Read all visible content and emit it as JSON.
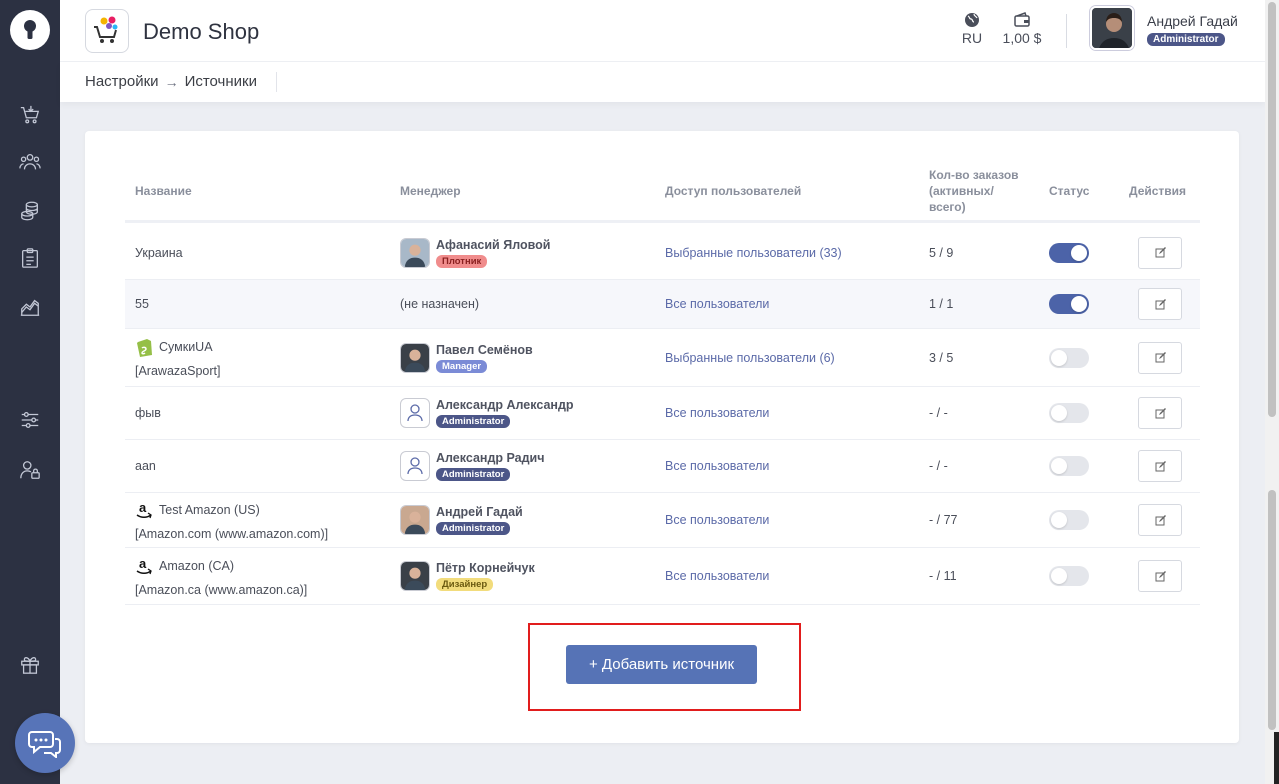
{
  "header": {
    "shop_name": "Demo Shop",
    "language": "RU",
    "balance": "1,00 $",
    "user_name": "Андрей Гадай",
    "user_role": "Administrator"
  },
  "breadcrumb": {
    "parent": "Настройки",
    "current": "Источники"
  },
  "table": {
    "columns": {
      "name": "Название",
      "manager": "Менеджер",
      "access": "Доступ пользователей",
      "orders": "Кол-во заказов (активных/ всего)",
      "status": "Статус",
      "actions": "Действия"
    },
    "rows": [
      {
        "name": "Украина",
        "sub": "",
        "icon": "",
        "manager": "Афанасий Яловой",
        "role": "Плотник",
        "role_color": "#f08c8c",
        "avatar": "photo",
        "access": "Выбранные пользователи (33)",
        "orders": "5 / 9",
        "status_on": true
      },
      {
        "name": "55",
        "sub": "",
        "icon": "",
        "manager": "(не назначен)",
        "role": "",
        "role_color": "",
        "avatar": "",
        "access": "Все пользователи",
        "orders": "1 / 1",
        "status_on": true
      },
      {
        "name": "СумкиUA",
        "sub": "[ArawazaSport]",
        "icon": "shopify-icon",
        "manager": "Павел Семёнов",
        "role": "Manager",
        "role_color": "#7b8bd6",
        "avatar": "photo",
        "access": "Выбранные пользователи (6)",
        "orders": "3 / 5",
        "status_on": false
      },
      {
        "name": "фыв",
        "sub": "",
        "icon": "",
        "manager": "Александр Александр",
        "role": "Administrator",
        "role_color": "#4c5688",
        "avatar": "user-icon",
        "access": "Все пользователи",
        "orders": "- / -",
        "status_on": false
      },
      {
        "name": "aan",
        "sub": "",
        "icon": "",
        "manager": "Александр Радич",
        "role": "Administrator",
        "role_color": "#4c5688",
        "avatar": "user-icon",
        "access": "Все пользователи",
        "orders": "- / -",
        "status_on": false
      },
      {
        "name": "Test Amazon (US)",
        "sub": "[Amazon.com (www.amazon.com)]",
        "icon": "amazon-icon",
        "manager": "Андрей Гадай",
        "role": "Administrator",
        "role_color": "#4c5688",
        "avatar": "photo",
        "access": "Все пользователи",
        "orders": "- / 77",
        "status_on": false
      },
      {
        "name": "Amazon (CA)",
        "sub": "[Amazon.ca (www.amazon.ca)]",
        "icon": "amazon-icon",
        "manager": "Пётр Корнейчук",
        "role": "Дизайнер",
        "role_color": "#f2dc7c",
        "avatar": "photo",
        "access": "Все пользователи",
        "orders": "- / 11",
        "status_on": false
      }
    ]
  },
  "add_button": "+ Добавить источник"
}
